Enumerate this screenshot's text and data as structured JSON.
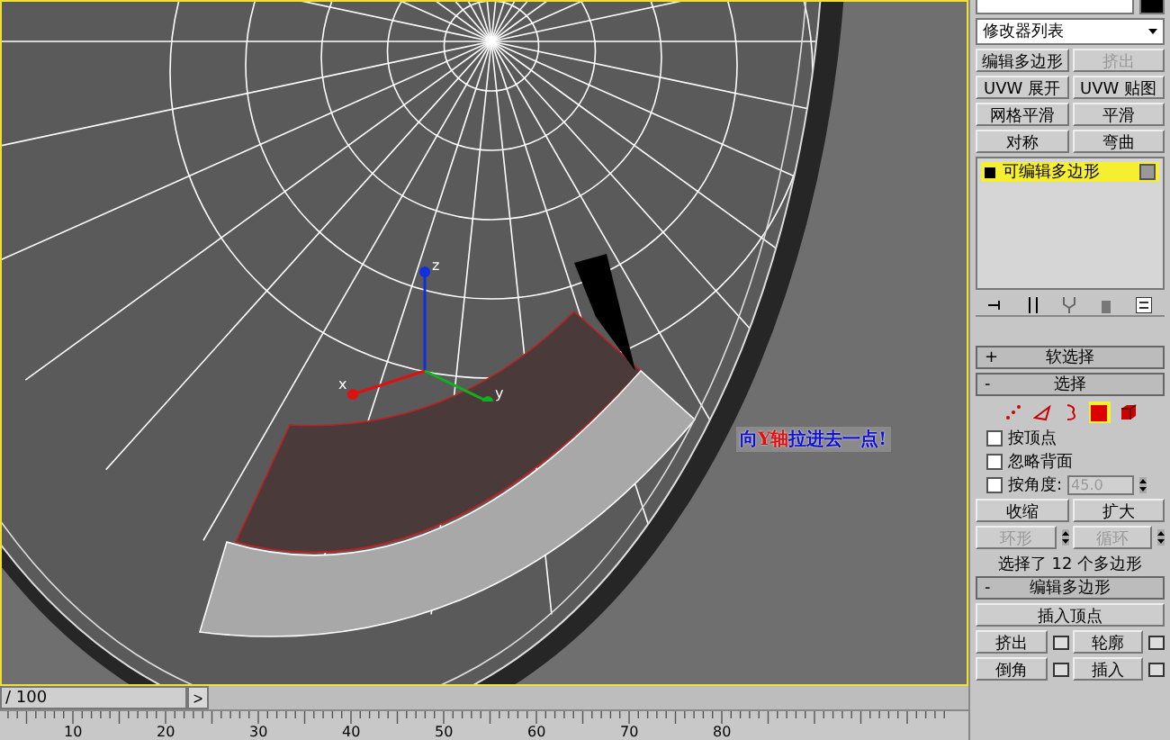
{
  "viewport": {
    "annotation": [
      {
        "text": "向",
        "color": "#1010d0"
      },
      {
        "text": "Y轴",
        "color": "#e01010"
      },
      {
        "text": "拉进去一点!",
        "color": "#1010d0"
      }
    ],
    "gizmo_axes": [
      {
        "label": "z",
        "kind": "z"
      },
      {
        "label": "x",
        "kind": "x"
      },
      {
        "label": "y",
        "kind": "y"
      }
    ]
  },
  "time_slider": {
    "label": "/ 100",
    "next": ">",
    "level": 0
  },
  "ruler": {
    "labels": [
      "10",
      "20",
      "30",
      "40",
      "50",
      "60",
      "70",
      "80"
    ]
  },
  "command_panel": {
    "modifier_list": "修改器列表",
    "modifier_buttons": [
      {
        "label": "编辑多边形",
        "disabled": false
      },
      {
        "label": "挤出",
        "disabled": true
      },
      {
        "label": "UVW 展开",
        "disabled": false
      },
      {
        "label": "UVW 贴图",
        "disabled": false
      },
      {
        "label": "网格平滑",
        "disabled": false
      },
      {
        "label": "平滑",
        "disabled": false
      },
      {
        "label": "对称",
        "disabled": false
      },
      {
        "label": "弯曲",
        "disabled": false
      }
    ],
    "stack": [
      {
        "label": "可编辑多边形",
        "selected": true
      }
    ],
    "rollouts": [
      {
        "sign": "+",
        "title": "软选择"
      },
      {
        "sign": "-",
        "title": "选择"
      }
    ],
    "subobjects": [
      {
        "kind": "vertex",
        "selected": false
      },
      {
        "kind": "edge",
        "selected": false
      },
      {
        "kind": "border",
        "selected": false
      },
      {
        "kind": "polygon",
        "selected": true
      },
      {
        "kind": "element",
        "selected": false
      }
    ],
    "checks": [
      {
        "label": "按顶点",
        "checked": false
      },
      {
        "label": "忽略背面",
        "checked": false
      },
      {
        "label": "按角度:",
        "checked": false
      }
    ],
    "angle": {
      "value": "45.0",
      "disabled": true
    },
    "grow_buttons": [
      {
        "label": "收缩",
        "disabled": false
      },
      {
        "label": "扩大",
        "disabled": false
      }
    ],
    "loop_buttons": [
      {
        "label": "环形",
        "disabled": true
      },
      {
        "label": "循环",
        "disabled": true
      }
    ],
    "status": "选择了 12 个多边形",
    "edit_rollout": {
      "sign": "-",
      "title": "编辑多边形"
    },
    "insert_vertex": "插入顶点",
    "edit_buttons": [
      {
        "label": "挤出"
      },
      {
        "label": "轮廓"
      },
      {
        "label": "倒角"
      },
      {
        "label": "插入"
      }
    ]
  }
}
